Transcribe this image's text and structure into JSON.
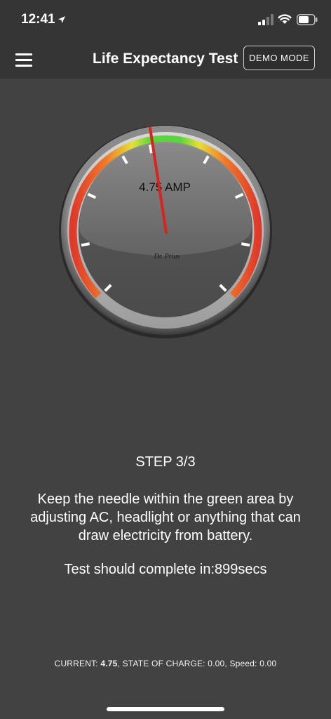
{
  "status_bar": {
    "time": "12:41",
    "icons": [
      "location-arrow-icon",
      "signal-icon",
      "wifi-icon",
      "battery-icon"
    ]
  },
  "nav": {
    "menu_icon": "hamburger-icon",
    "title": "Life Expectancy Test",
    "demo_label": "DEMO MODE"
  },
  "gauge": {
    "reading_label": "4.75 AMP",
    "brand": "Dr. Prius",
    "needle_value": 4.75,
    "colors": {
      "green": "#59d63c",
      "yellow": "#e6df3a",
      "orange": "#f07a2a",
      "red": "#e0392a",
      "needle": "#d9231e"
    }
  },
  "step": {
    "label": "STEP 3/3",
    "instruction": "Keep the needle within the green area by adjusting AC, headlight or anything that can draw electricity from battery.",
    "countdown": "Test should complete in:899secs"
  },
  "readout": {
    "current_label": "CURRENT: ",
    "current_value": "4.75",
    "rest": ", STATE OF CHARGE: 0.00, Speed: 0.00"
  }
}
